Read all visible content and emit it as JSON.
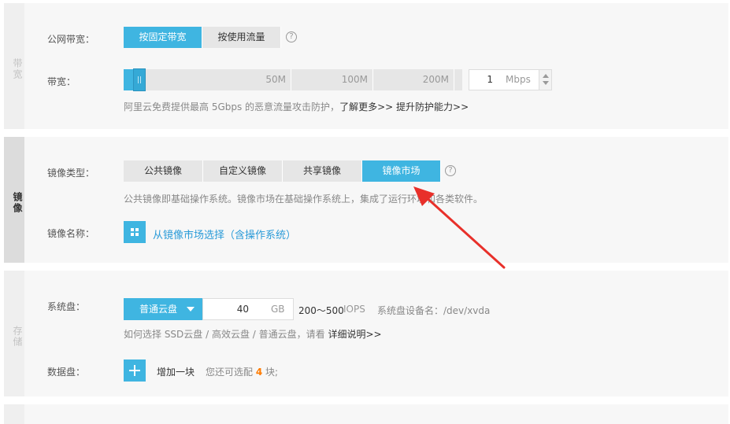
{
  "bandwidth_section": {
    "tab_label": "带宽",
    "billing_label": "公网带宽：",
    "billing_options": [
      "按固定带宽",
      "按使用流量"
    ],
    "billing_selected": 0,
    "bandwidth_label": "带宽：",
    "slider_ticks": [
      "50M",
      "100M",
      "200M"
    ],
    "value": "1",
    "unit": "Mbps",
    "hint_text": "阿里云免费提供最高 5Gbps 的恶意流量攻击防护，",
    "hint_link1": "了解更多>>",
    "hint_link2": "提升防护能力>>"
  },
  "image_section": {
    "tab_label": "镜像",
    "type_label": "镜像类型：",
    "type_options": [
      "公共镜像",
      "自定义镜像",
      "共享镜像",
      "镜像市场"
    ],
    "type_selected": 3,
    "hint": "公共镜像即基础操作系统。镜像市场在基础操作系统上，集成了运行环境和各类软件。",
    "name_label": "镜像名称：",
    "market_link": "从镜像市场选择（含操作系统）"
  },
  "storage_section": {
    "tab_label": "存储",
    "system_disk_label": "系统盘：",
    "disk_type": "普通云盘",
    "disk_size": "40",
    "disk_unit": "GB",
    "iops_range": "200～500",
    "iops_unit": "IOPS",
    "device_label": "系统盘设备名：/dev/xvda",
    "hint_text": "如何选择 SSD云盘 / 高效云盘 / 普通云盘，请看",
    "hint_link": "详细说明>>",
    "data_disk_label": "数据盘：",
    "add_label": "增加一块",
    "remaining_prefix": "您还可选配",
    "remaining_count": "4",
    "remaining_suffix": "块;"
  },
  "colors": {
    "accent": "#3fb5e1",
    "arrow": "#e8302a",
    "link": "#2a9bd8",
    "highlight": "#ff7b00"
  },
  "icons": {
    "help": "question-circle-icon",
    "market": "grid-icon",
    "add": "plus-icon",
    "dropdown": "caret-down-icon"
  }
}
